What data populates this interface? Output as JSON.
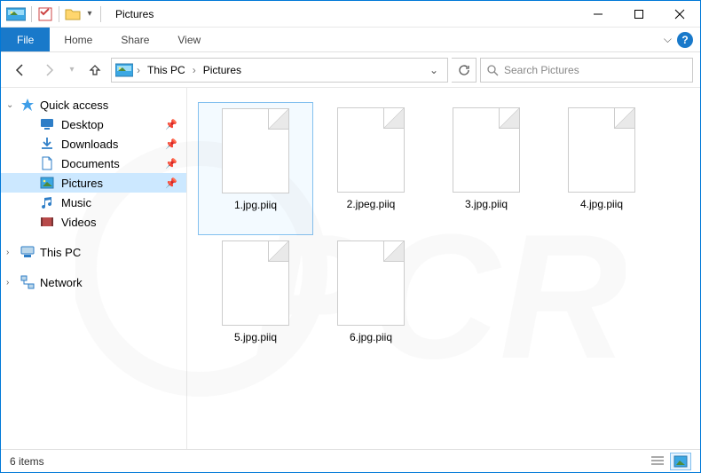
{
  "window": {
    "title": "Pictures"
  },
  "ribbon": {
    "file": "File",
    "tabs": [
      "Home",
      "Share",
      "View"
    ]
  },
  "breadcrumb": {
    "segments": [
      "This PC",
      "Pictures"
    ]
  },
  "search": {
    "placeholder": "Search Pictures"
  },
  "sidebar": {
    "quick_access": {
      "label": "Quick access",
      "items": [
        {
          "label": "Desktop",
          "pinned": true,
          "icon": "desktop-icon"
        },
        {
          "label": "Downloads",
          "pinned": true,
          "icon": "downloads-icon"
        },
        {
          "label": "Documents",
          "pinned": true,
          "icon": "documents-icon"
        },
        {
          "label": "Pictures",
          "pinned": true,
          "icon": "pictures-icon",
          "selected": true
        },
        {
          "label": "Music",
          "pinned": false,
          "icon": "music-icon"
        },
        {
          "label": "Videos",
          "pinned": false,
          "icon": "videos-icon"
        }
      ]
    },
    "this_pc": {
      "label": "This PC"
    },
    "network": {
      "label": "Network"
    }
  },
  "files": [
    {
      "name": "1.jpg.piiq",
      "selected": true
    },
    {
      "name": "2.jpeg.piiq"
    },
    {
      "name": "3.jpg.piiq"
    },
    {
      "name": "4.jpg.piiq"
    },
    {
      "name": "5.jpg.piiq"
    },
    {
      "name": "6.jpg.piiq"
    }
  ],
  "status": {
    "text": "6 items"
  }
}
